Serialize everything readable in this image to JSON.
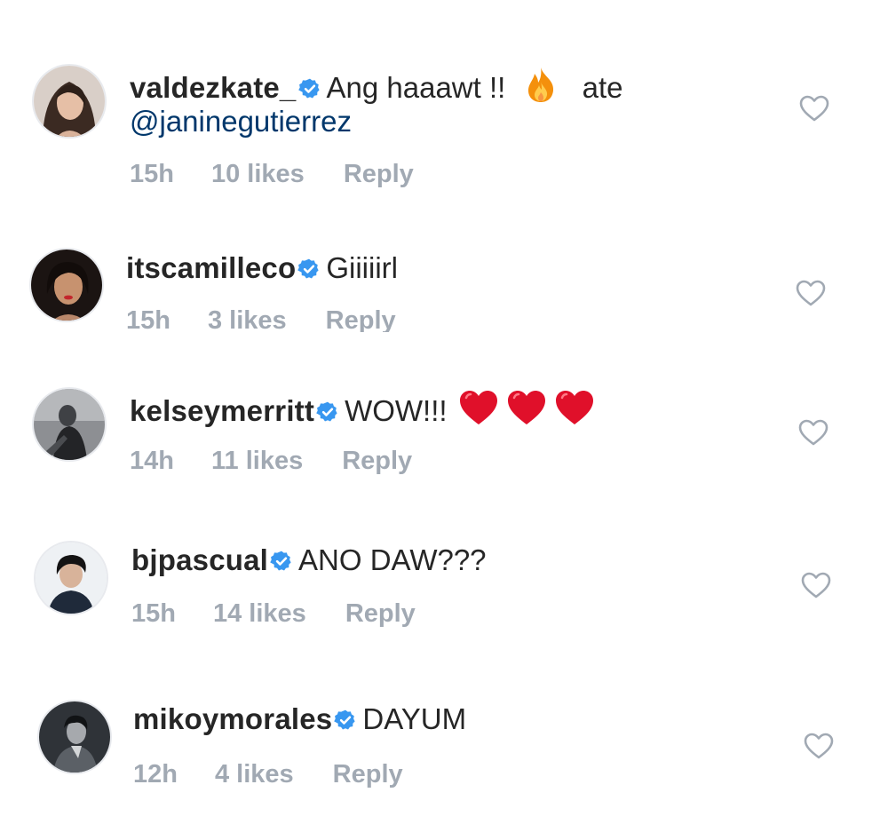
{
  "colors": {
    "verified_badge": "#3897f0",
    "meta_text": "#a1a9b3",
    "mention": "#00376b",
    "heart_outline": "#a1a9b3",
    "emoji_heart": "#e0102a"
  },
  "comments": [
    {
      "username": "valdezkate_",
      "verified": true,
      "text": "Ang haaawt !!",
      "emoji": "fire-emoji",
      "text_after": "ate",
      "mention": "@janinegutierrez",
      "time": "15h",
      "likes": "10 likes",
      "reply": "Reply"
    },
    {
      "username": "itscamilleco",
      "verified": true,
      "text": "Giiiiirl",
      "time": "15h",
      "likes": "3 likes",
      "reply": "Reply"
    },
    {
      "username": "kelseymerritt",
      "verified": true,
      "text": "WOW!!!",
      "emoji": "red-heart-emoji x3",
      "time": "14h",
      "likes": "11 likes",
      "reply": "Reply"
    },
    {
      "username": "bjpascual",
      "verified": true,
      "text": "ANO DAW???",
      "time": "15h",
      "likes": "14 likes",
      "reply": "Reply"
    },
    {
      "username": "mikoymorales",
      "verified": true,
      "text": "DAYUM",
      "time": "12h",
      "likes": "4 likes",
      "reply": "Reply"
    }
  ]
}
